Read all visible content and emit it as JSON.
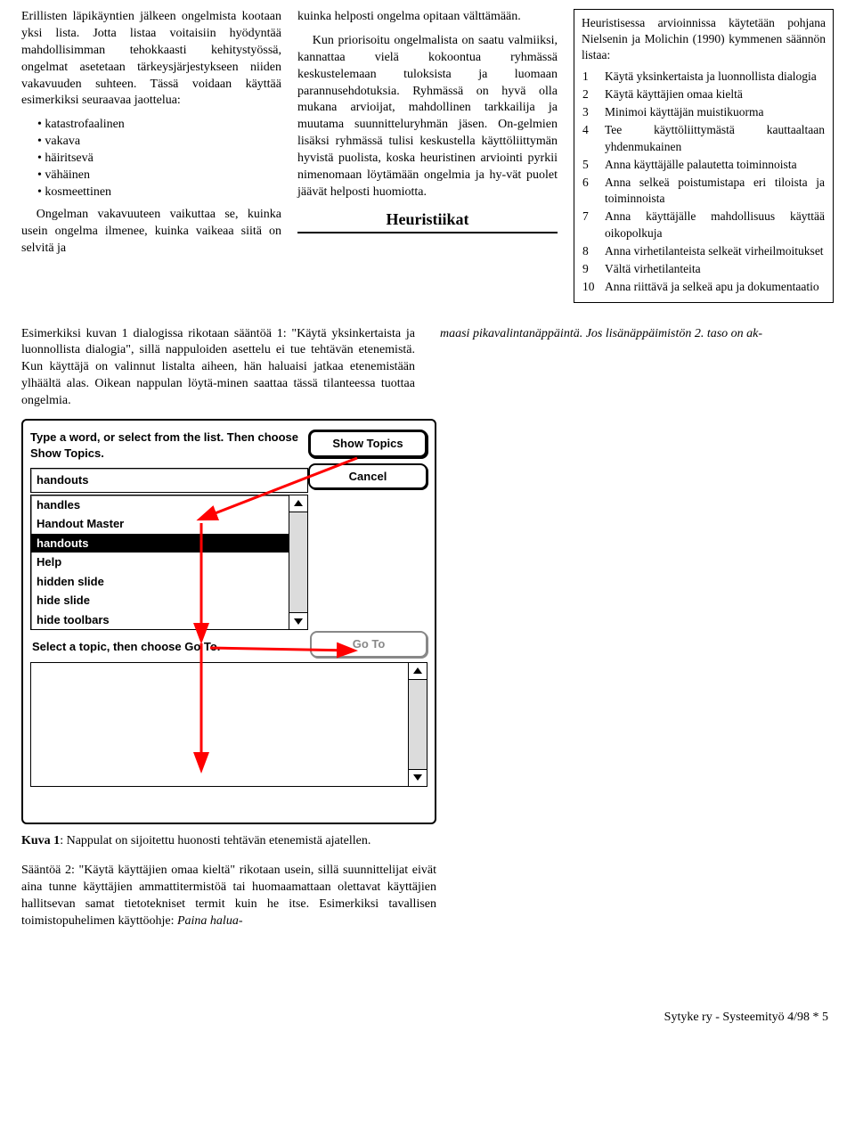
{
  "col1": {
    "p1": "Erillisten läpikäyntien jälkeen ongelmista kootaan yksi lista. Jotta listaa voitaisiin hyödyntää mahdollisimman tehokkaasti kehitystyössä, ongelmat asetetaan tärkeysjärjestykseen niiden vakavuuden suhteen. Tässä voidaan käyttää esimerkiksi seuraavaa jaottelua:",
    "bullets": [
      "katastrofaalinen",
      "vakava",
      "häiritsevä",
      "vähäinen",
      "kosmeettinen"
    ],
    "p2": "Ongelman vakavuuteen vaikuttaa se, kuinka usein ongelma ilmenee, kuinka vaikeaa siitä on selvitä ja"
  },
  "col2": {
    "p1": "kuinka helposti ongelma opitaan välttämään.",
    "p2": "Kun priorisoitu ongelmalista on saatu valmiiksi, kannattaa vielä kokoontua ryhmässä keskustelemaan tuloksista ja luomaan parannusehdotuksia. Ryhmässä on hyvä olla mukana arvioijat, mahdollinen tarkkailija ja muutama suunnitteluryhmän jäsen. On-gelmien lisäksi ryhmässä tulisi keskustella käyttöliittymän hyvistä puolista, koska heuristinen arviointi pyrkii nimenomaan löytämään ongelmia ja hy-vät puolet jäävät helposti huomiotta.",
    "heur_title": "Heuristiikat"
  },
  "col3": {
    "lead": "Heuristisessa arvioinnissa käytetään pohjana Nielsenin ja Molichin (1990) kymmenen säännön listaa:",
    "rules": [
      {
        "n": "1",
        "t": "Käytä yksinkertaista ja luonnollista dialogia"
      },
      {
        "n": "2",
        "t": "Käytä käyttäjien omaa kieltä"
      },
      {
        "n": "3",
        "t": "Minimoi käyttäjän muistikuorma"
      },
      {
        "n": "4",
        "t": "Tee käyttöliittymästä kauttaaltaan yhdenmukainen"
      },
      {
        "n": "5",
        "t": "Anna käyttäjälle palautetta toiminnoista"
      },
      {
        "n": "6",
        "t": "Anna selkeä poistumistapa eri tiloista ja toiminnoista"
      },
      {
        "n": "7",
        "t": "Anna käyttäjälle mahdollisuus käyttää oikopolkuja"
      },
      {
        "n": "8",
        "t": "Anna virhetilanteista selkeät virheilmoitukset"
      },
      {
        "n": "9",
        "t": "Vältä virhetilanteita"
      },
      {
        "n": "10",
        "t": "Anna riittävä ja selkeä apu ja dokumentaatio"
      }
    ]
  },
  "mid": {
    "left": "Esimerkiksi kuvan 1 dialogissa rikotaan sääntöä 1: \"Käytä yksinkertaista ja luonnollista dialogia\", sillä nappuloiden asettelu ei tue tehtävän etenemistä. Kun käyttäjä on valinnut listalta aiheen, hän haluaisi jatkaa etenemistään ylhäältä alas. Oikean nappulan löytä-minen saattaa tässä tilanteessa tuottaa ongelmia.",
    "right_italic": "maasi pikavalintanäppäintä. Jos lisänäppäimistön 2. taso on ak-"
  },
  "dlg": {
    "label_top": "Type a word, or select from the list. Then choose Show Topics.",
    "input_value": "handouts",
    "btn_show": "Show Topics",
    "btn_cancel": "Cancel",
    "btn_goto": "Go To",
    "sub_label": "Select a topic, then choose Go To.",
    "items": [
      {
        "t": "handles",
        "sel": false
      },
      {
        "t": "Handout Master",
        "sel": false
      },
      {
        "t": "handouts",
        "sel": true
      },
      {
        "t": "Help",
        "sel": false
      },
      {
        "t": "hidden slide",
        "sel": false
      },
      {
        "t": "hide slide",
        "sel": false
      },
      {
        "t": "hide toolbars",
        "sel": false
      }
    ]
  },
  "caption": {
    "b": "Kuva 1",
    "rest": ": Nappulat on sijoitettu huonosti tehtävän etenemistä ajatellen."
  },
  "after": "Sääntöä 2: \"Käytä käyttäjien omaa kieltä\" rikotaan usein, sillä suunnittelijat eivät aina tunne käyttäjien ammattitermistöä tai huomaamattaan olettavat käyttäjien hallitsevan samat tietotekniset termit kuin he itse. Esimerkiksi tavallisen toimistopuhelimen käyttöohje: ",
  "after_italic": "Paina halua-",
  "footer": "Sytyke ry -  Systeemityö 4/98 * 5"
}
